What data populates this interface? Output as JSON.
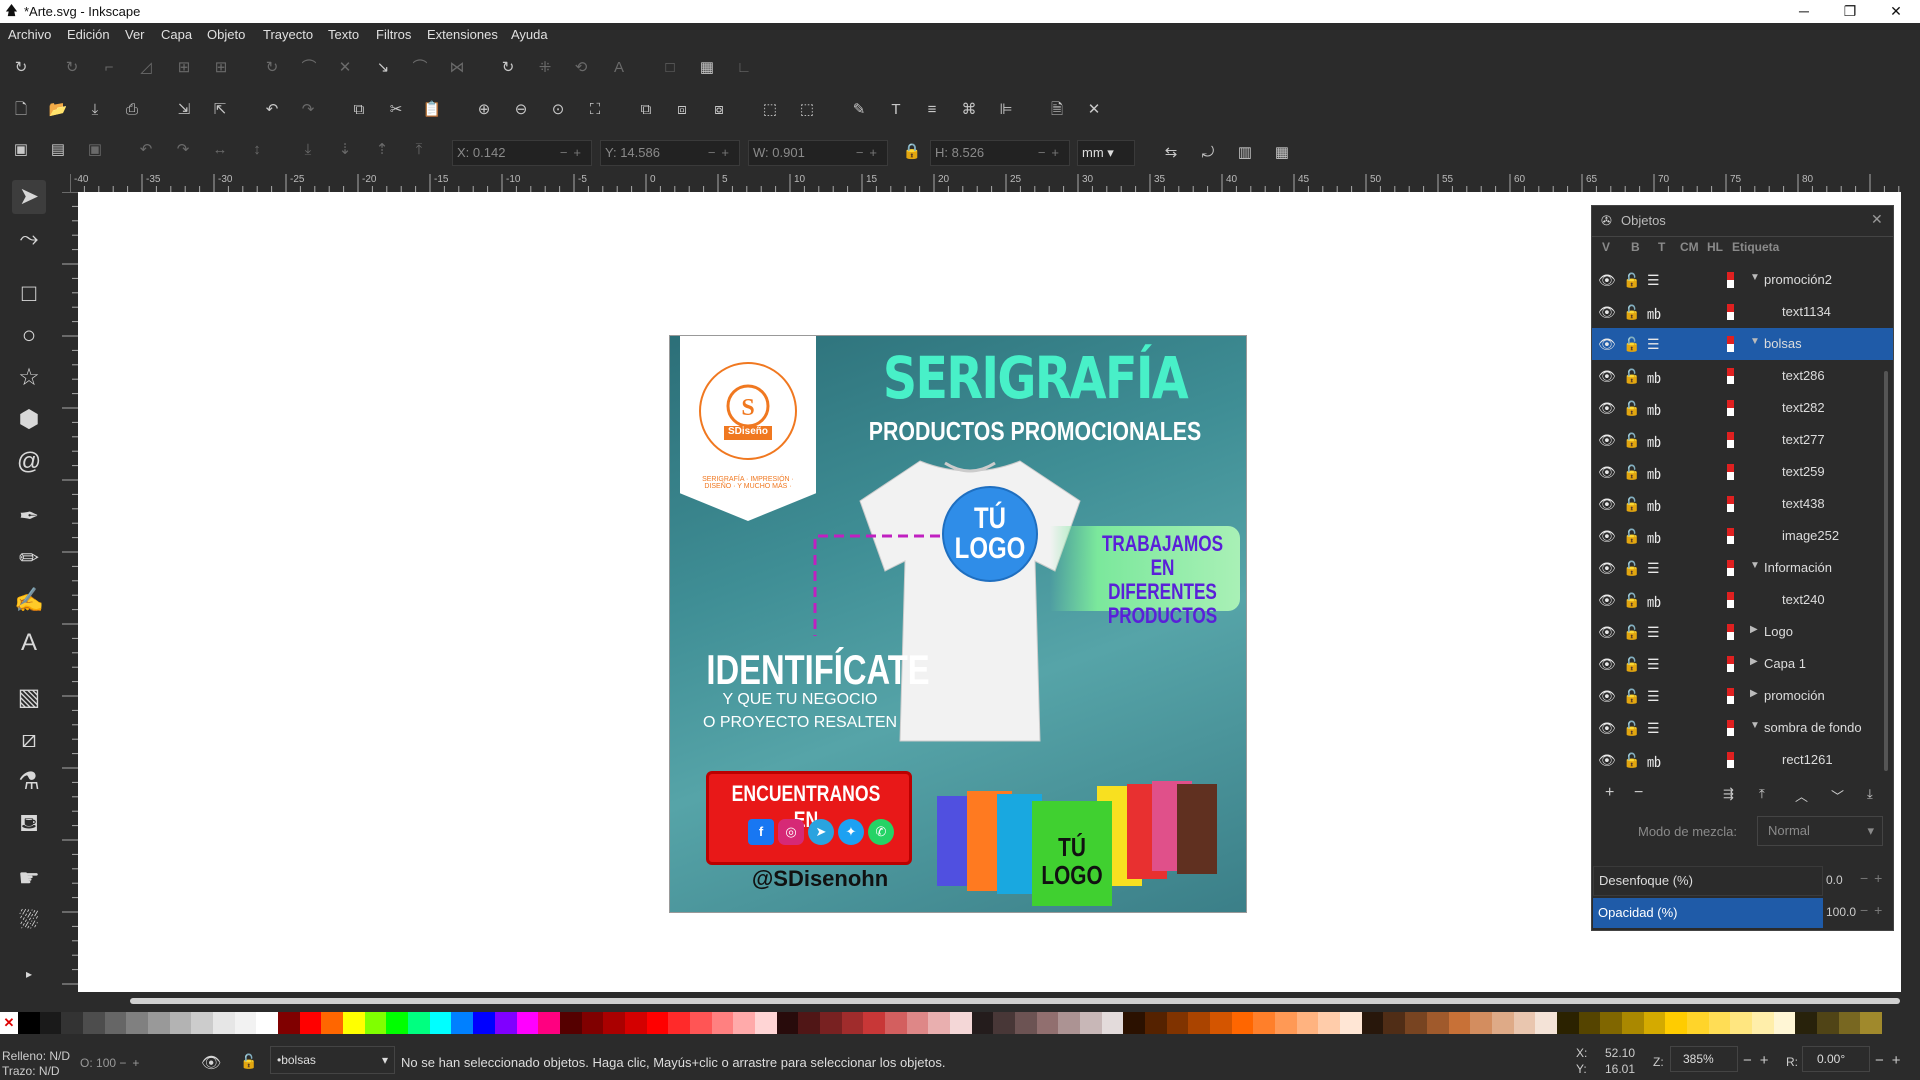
{
  "window": {
    "title": "*Arte.svg - Inkscape",
    "minimize": "─",
    "maximize": "❐",
    "close": "✕"
  },
  "menu": [
    "Archivo",
    "Edición",
    "Ver",
    "Capa",
    "Objeto",
    "Trayecto",
    "Texto",
    "Filtros",
    "Extensiones",
    "Ayuda"
  ],
  "toolcontrols": {
    "x_label": "X:",
    "x_value": "0.142",
    "y_label": "Y:",
    "y_value": "14.586",
    "w_label": "W:",
    "w_value": "0.901",
    "h_label": "H:",
    "h_value": "8.526",
    "unit": "mm"
  },
  "ruler_labels": [
    "-40",
    "-35",
    "-30",
    "-25",
    "-20",
    "-15",
    "-10",
    "-5",
    "0",
    "5",
    "10",
    "15",
    "20",
    "25",
    "30",
    "35",
    "40",
    "45",
    "50",
    "55",
    "60",
    "65",
    "70",
    "75",
    "80"
  ],
  "artwork": {
    "title": "SERIGRAFÍA",
    "subtitle": "PRODUCTOS PROMOCIONALES",
    "logo_ring_text": "SERIGRAFÍA · IMPRESIÓN · DISEÑO · Y MUCHO MÁS ·",
    "logo_brand": "SDiseño",
    "shirt_logo_line1": "TÚ",
    "shirt_logo_line2": "LOGO",
    "banner_line1": "TRABAJAMOS EN",
    "banner_line2": "DIFERENTES",
    "banner_line3": "PRODUCTOS",
    "identify": "IDENTIFÍCATE",
    "tagline1": "Y QUE TU NEGOCIO",
    "tagline2": "O PROYECTO RESALTEN",
    "find_us": "ENCUENTRANOS EN",
    "handle": "@SDisenohn",
    "bag_logo_line1": "TÚ",
    "bag_logo_line2": "LOGO"
  },
  "objects_panel": {
    "title": "Objetos",
    "columns": [
      "V",
      "B",
      "T",
      "CM",
      "HL",
      "Etiqueta"
    ],
    "rows": [
      {
        "label": "promoción2",
        "indent": 0,
        "group": true,
        "expanded": true,
        "selected": false
      },
      {
        "label": "text1134",
        "indent": 1,
        "group": false,
        "selected": false
      },
      {
        "label": "bolsas",
        "indent": 0,
        "group": true,
        "expanded": true,
        "selected": true
      },
      {
        "label": "text286",
        "indent": 1,
        "group": false,
        "selected": false
      },
      {
        "label": "text282",
        "indent": 1,
        "group": false,
        "selected": false
      },
      {
        "label": "text277",
        "indent": 1,
        "group": false,
        "selected": false
      },
      {
        "label": "text259",
        "indent": 1,
        "group": false,
        "selected": false
      },
      {
        "label": "text438",
        "indent": 1,
        "group": false,
        "selected": false
      },
      {
        "label": "image252",
        "indent": 1,
        "group": false,
        "selected": false
      },
      {
        "label": "Información",
        "indent": 0,
        "group": true,
        "expanded": true,
        "selected": false
      },
      {
        "label": "text240",
        "indent": 1,
        "group": false,
        "selected": false
      },
      {
        "label": "Logo",
        "indent": 0,
        "group": true,
        "expanded": false,
        "selected": false
      },
      {
        "label": "Capa 1",
        "indent": 0,
        "group": true,
        "expanded": false,
        "selected": false
      },
      {
        "label": "promoción",
        "indent": 0,
        "group": true,
        "expanded": false,
        "selected": false
      },
      {
        "label": "sombra de fondo",
        "indent": 0,
        "group": true,
        "expanded": true,
        "selected": false
      },
      {
        "label": "rect1261",
        "indent": 1,
        "group": false,
        "selected": false
      }
    ],
    "blend_label": "Modo de mezcla:",
    "blend_value": "Normal",
    "blur_label": "Desenfoque (%)",
    "blur_value": "0.0",
    "opacity_label": "Opacidad (%)",
    "opacity_value": "100.0"
  },
  "status": {
    "fill_label": "Relleno:",
    "fill_value": "N/D",
    "stroke_label": "Trazo:",
    "stroke_value": "N/D",
    "o_label": "O:",
    "o_value": "100",
    "layer": "•bolsas",
    "message": "No se han seleccionado objetos. Haga clic, Mayús+clic o arrastre para seleccionar los objetos.",
    "cursor_x_label": "X:",
    "cursor_x": "52.10",
    "cursor_y_label": "Y:",
    "cursor_y": "16.01",
    "zoom_label": "Z:",
    "zoom": "385%",
    "rotation_label": "R:",
    "rotation": "0.00°"
  },
  "palette": [
    "#000000",
    "#1a1a1a",
    "#333333",
    "#4d4d4d",
    "#666666",
    "#808080",
    "#999999",
    "#b3b3b3",
    "#cccccc",
    "#e6e6e6",
    "#f2f2f2",
    "#ffffff",
    "#800000",
    "#ff0000",
    "#ff6600",
    "#ffff00",
    "#80ff00",
    "#00ff00",
    "#00ff80",
    "#00ffff",
    "#0080ff",
    "#0000ff",
    "#8000ff",
    "#ff00ff",
    "#ff0080",
    "#550000",
    "#800000",
    "#aa0000",
    "#d40000",
    "#ff0000",
    "#ff2a2a",
    "#ff5555",
    "#ff8080",
    "#ffaaaa",
    "#ffd5d5",
    "#280b0b",
    "#501616",
    "#782121",
    "#a02c2c",
    "#c83737",
    "#d35f5f",
    "#de8787",
    "#e9afaf",
    "#f4d7d7",
    "#241c1c",
    "#483737",
    "#6c5353",
    "#916f6f",
    "#ac9393",
    "#c8b7b7",
    "#e3dbdb",
    "#2b1100",
    "#552200",
    "#803300",
    "#aa4400",
    "#d45500",
    "#ff6600",
    "#ff7f2a",
    "#ff9955",
    "#ffb380",
    "#ffccaa",
    "#ffe6d5",
    "#28170b",
    "#502d16",
    "#784421",
    "#a05a2c",
    "#c87137",
    "#d38d5f",
    "#deaa87",
    "#e9c6af",
    "#f4e3d7",
    "#2b2200",
    "#554400",
    "#806600",
    "#aa8800",
    "#d4aa00",
    "#ffcc00",
    "#ffd42a",
    "#ffdd55",
    "#ffe680",
    "#ffeeaa",
    "#fff6d5",
    "#28220b",
    "#504416",
    "#786721",
    "#a0892c"
  ]
}
